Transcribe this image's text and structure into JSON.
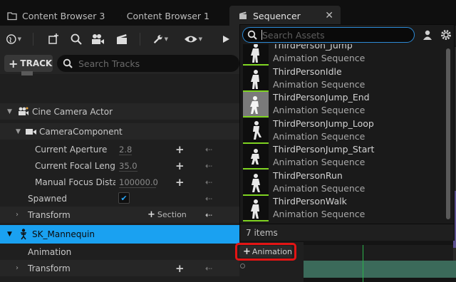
{
  "tabs": [
    {
      "label": "Content Browser 3",
      "icon": "folder-icon"
    },
    {
      "label": "Content Browser 1",
      "icon": "folder-icon"
    },
    {
      "label": "Sequencer",
      "icon": "clapper-icon",
      "active": true
    }
  ],
  "toolbar": {
    "icons": [
      "world-icon",
      "add-keyframe-icon",
      "search-icon",
      "camera-icon",
      "clapperboard-icon",
      "wrench-icon",
      "eye-icon",
      "play-icon"
    ]
  },
  "tracks": {
    "add_label": "TRACK",
    "search_placeholder": "Search Tracks"
  },
  "tree": {
    "cine_camera": "Cine Camera Actor",
    "camera_component": "CameraComponent",
    "aperture_label": "Current Aperture",
    "aperture_value": "2.8",
    "focal_label": "Current Focal Length",
    "focal_value": "35.0",
    "focus_label": "Manual Focus Distan",
    "focus_value": "100000.0",
    "spawned_label": "Spawned",
    "transform_label": "Transform",
    "section_label": "Section",
    "mannequin_label": "SK_Mannequin",
    "animation_label": "Animation",
    "animation_button": "Animation",
    "transform2_label": "Transform"
  },
  "picker": {
    "search_placeholder": "Search Assets",
    "assets": [
      {
        "name": "ThirdPerson_Jump",
        "type": "Animation Sequence"
      },
      {
        "name": "ThirdPersonIdle",
        "type": "Animation Sequence"
      },
      {
        "name": "ThirdPersonJump_End",
        "type": "Animation Sequence"
      },
      {
        "name": "ThirdPersonJump_Loop",
        "type": "Animation Sequence"
      },
      {
        "name": "ThirdPersonJump_Start",
        "type": "Animation Sequence"
      },
      {
        "name": "ThirdPersonRun",
        "type": "Animation Sequence"
      },
      {
        "name": "ThirdPersonWalk",
        "type": "Animation Sequence"
      }
    ],
    "count_label": "7 items"
  },
  "colors": {
    "selection_blue": "#1aa1f1",
    "highlight_red": "#e31414",
    "accent_green": "#7ed321"
  }
}
